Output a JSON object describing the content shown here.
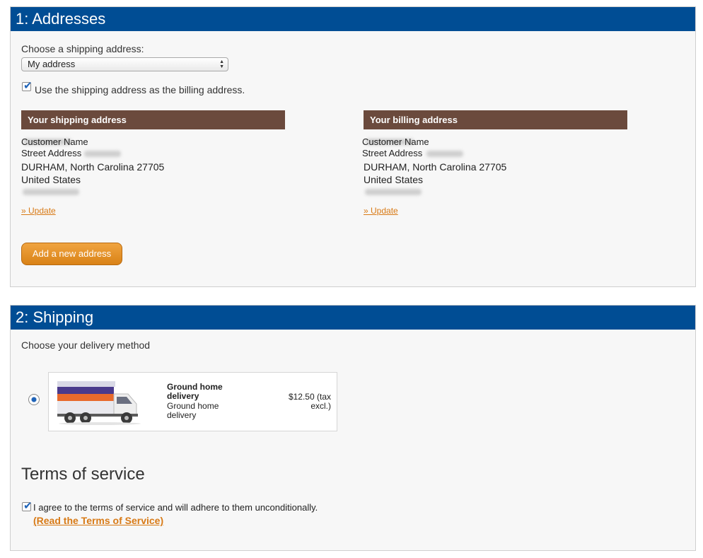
{
  "addresses": {
    "header": "1: Addresses",
    "choose_label": "Choose a shipping address:",
    "selected_address": "My address",
    "same_billing_label": "Use the shipping address as the billing address.",
    "same_billing_checked": true,
    "shipping": {
      "heading": "Your shipping address",
      "name": "Customer Name",
      "street": "Street Address",
      "city_line": "DURHAM, North Carolina 27705",
      "country": "United States",
      "update_label": "» Update"
    },
    "billing": {
      "heading": "Your billing address",
      "name": "Customer Name",
      "street": "Street Address",
      "city_line": "DURHAM, North Carolina 27705",
      "country": "United States",
      "update_label": "» Update"
    },
    "add_button": "Add a new address"
  },
  "shipping": {
    "header": "2: Shipping",
    "choose_label": "Choose your delivery method",
    "carrier": {
      "name": "Ground home delivery",
      "description": "Ground home delivery",
      "price": "$12.50 (tax excl.)",
      "selected": true,
      "icon": "delivery-truck-icon"
    },
    "tos": {
      "title": "Terms of service",
      "agree_label": "I agree to the terms of service and will adhere to them unconditionally.",
      "agree_checked": true,
      "read_link": "(Read the Terms of Service)"
    }
  },
  "colors": {
    "header_blue": "#004d94",
    "address_brown": "#6b4a3d",
    "accent_orange": "#d87a16"
  }
}
